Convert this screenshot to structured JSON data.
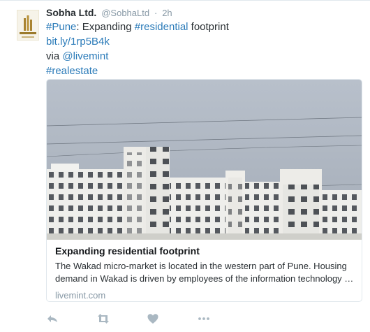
{
  "tweet": {
    "author_name": "Sobha Ltd.",
    "handle": "@SobhaLtd",
    "separator": "·",
    "time": "2h",
    "text": {
      "hashtag_pune": "#Pune",
      "colon": ":",
      "word_expanding": " Expanding ",
      "hashtag_residential": "#residential",
      "word_footprint": " footprint",
      "short_link": "bit.ly/1rp5B4k",
      "via": "via ",
      "mention": "@livemint",
      "hashtag_realestate": "#realestate"
    }
  },
  "card": {
    "title": "Expanding residential footprint",
    "description_line1": "The Wakad micro-market is located in the western part of Pune. Housing",
    "description_line2": "demand in Wakad is driven by employees of the information technology …",
    "domain": "livemint.com"
  },
  "actions": {
    "reply": "reply-icon",
    "retweet": "retweet-icon",
    "like": "heart-icon",
    "more": "more-icon"
  },
  "colors": {
    "link": "#2b7bb9",
    "muted": "#8899a6",
    "icon": "#aab8c2"
  }
}
